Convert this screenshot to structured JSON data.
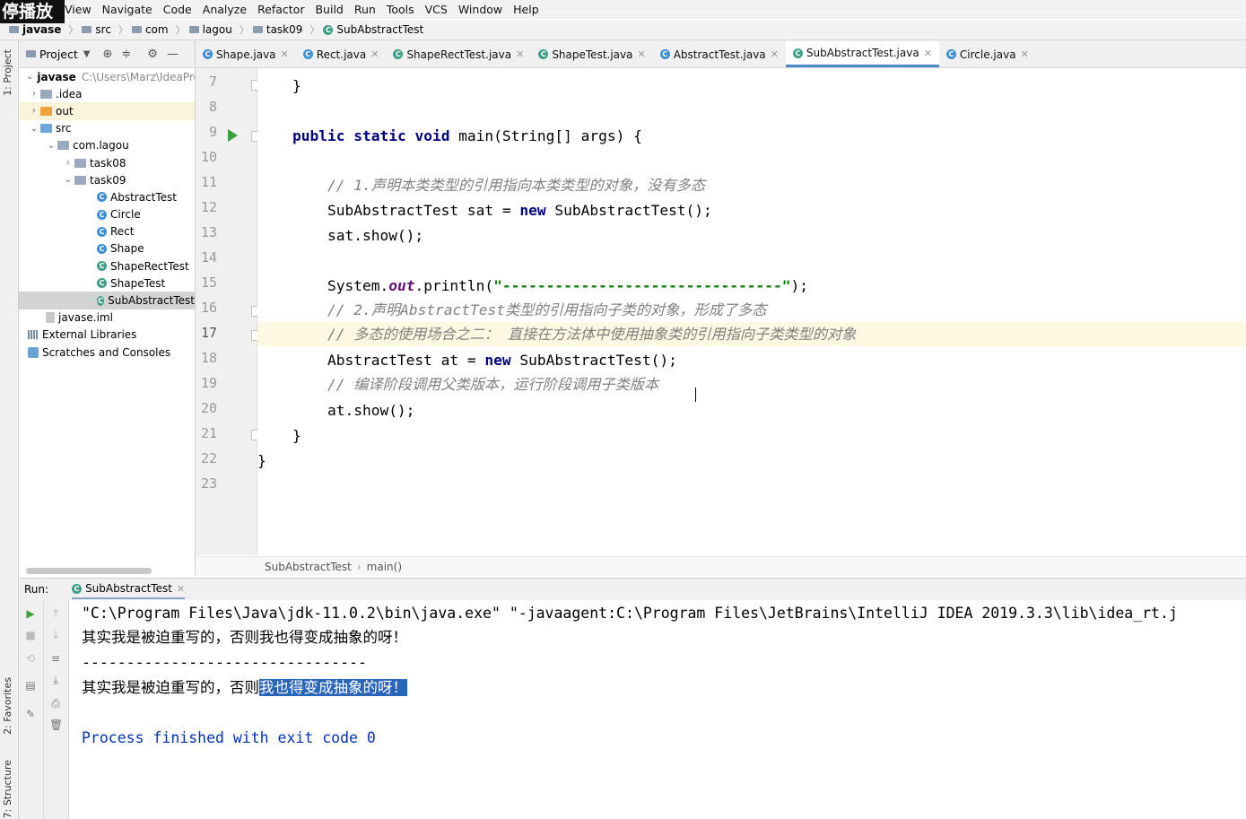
{
  "overlay_badge": "停播放",
  "menu": [
    "View",
    "Navigate",
    "Code",
    "Analyze",
    "Refactor",
    "Build",
    "Run",
    "Tools",
    "VCS",
    "Window",
    "Help"
  ],
  "navbar": {
    "project": "javase",
    "crumbs": [
      "src",
      "com",
      "lagou",
      "task09"
    ],
    "file": "SubAbstractTest"
  },
  "left_strip": {
    "project_tab": "1: Project",
    "favorites_tab": "2: Favorites",
    "structure_tab": "7: Structure"
  },
  "project_panel": {
    "title": "Project",
    "root": {
      "name": "javase",
      "path": "C:\\Users\\Marz\\IdeaPro"
    },
    "items": [
      {
        "label": ".idea"
      },
      {
        "label": "out"
      },
      {
        "label": "src"
      },
      {
        "label": "com.lagou"
      },
      {
        "label": "task08"
      },
      {
        "label": "task09"
      },
      {
        "label": "AbstractTest"
      },
      {
        "label": "Circle"
      },
      {
        "label": "Rect"
      },
      {
        "label": "Shape"
      },
      {
        "label": "ShapeRectTest"
      },
      {
        "label": "ShapeTest"
      },
      {
        "label": "SubAbstractTest"
      },
      {
        "label": "javase.iml"
      },
      {
        "label": "External Libraries"
      },
      {
        "label": "Scratches and Consoles"
      }
    ]
  },
  "tabs": [
    {
      "label": "Shape.java"
    },
    {
      "label": "Rect.java"
    },
    {
      "label": "ShapeRectTest.java"
    },
    {
      "label": "ShapeTest.java"
    },
    {
      "label": "AbstractTest.java"
    },
    {
      "label": "SubAbstractTest.java"
    },
    {
      "label": "Circle.java"
    }
  ],
  "editor": {
    "line_numbers": [
      "7",
      "8",
      "9",
      "10",
      "11",
      "12",
      "13",
      "14",
      "15",
      "16",
      "17",
      "18",
      "19",
      "20",
      "21",
      "22",
      "23"
    ],
    "breadcrumb": {
      "class": "SubAbstractTest",
      "method": "main()"
    },
    "code": {
      "l7_brace": "}",
      "l9_public": "public",
      "l9_static": "static",
      "l9_void": "void",
      "l9_rest": " main(String[] args) {",
      "l11_comment": "// 1.声明本类类型的引用指向本类类型的对象，没有多态",
      "l12_a": "SubAbstractTest sat = ",
      "l12_new": "new",
      "l12_b": " SubAbstractTest();",
      "l13": "sat.show();",
      "l15_a": "System.",
      "l15_out": "out",
      "l15_b": ".println(",
      "l15_str": "\"--------------------------------\"",
      "l15_c": ");",
      "l16_comment": "// 2.声明AbstractTest类型的引用指向子类的对象，形成了多态",
      "l17_comment": "// 多态的使用场合之二： 直接在方法体中使用抽象类的引用指向子类类型的对象",
      "l18_a": "AbstractTest at = ",
      "l18_new": "new",
      "l18_b": " SubAbstractTest();",
      "l19_comment": "// 编译阶段调用父类版本，运行阶段调用子类版本",
      "l20": "at.show();",
      "l21_brace": "}",
      "l22_brace": "}"
    }
  },
  "run": {
    "label": "Run:",
    "tab": "SubAbstractTest",
    "console": {
      "cmd": "\"C:\\Program Files\\Java\\jdk-11.0.2\\bin\\java.exe\" \"-javaagent:C:\\Program Files\\JetBrains\\IntelliJ IDEA 2019.3.3\\lib\\idea_rt.j",
      "out1": "其实我是被迫重写的，否则我也得变成抽象的呀！",
      "sep": "--------------------------------",
      "out2_a": "其实我是被迫重写的，否则",
      "out2_sel": "我也得变成抽象的呀！",
      "exit": "Process finished with exit code 0"
    }
  }
}
